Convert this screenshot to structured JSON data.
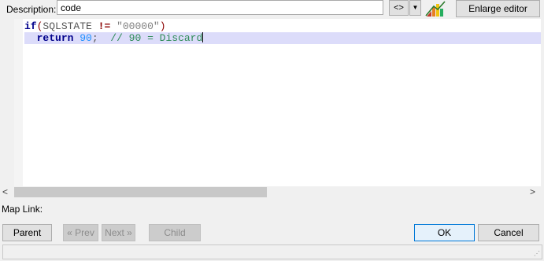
{
  "description": {
    "label": "Description:",
    "value": "code"
  },
  "toolbar": {
    "code_toggle_label": "<>",
    "dropdown_icon": "chevron-down-icon",
    "chart_icon": "chart-icon",
    "enlarge_label": "Enlarge editor"
  },
  "editor": {
    "lines": [
      {
        "tokens": {
          "kw": "if",
          "open": "(",
          "ident": "SQLSTATE",
          "op": "!=",
          "str": "\"00000\"",
          "close": ")"
        }
      },
      {
        "tokens": {
          "kw": "return",
          "num": "90",
          "semi": ";",
          "comment": "// 90 = Discard"
        }
      }
    ],
    "highlight_color": "#dcdcfa"
  },
  "scroll": {
    "left_icon": "scroll-left-icon",
    "right_icon": "scroll-right-icon"
  },
  "map_link": {
    "label": "Map Link:"
  },
  "buttons": {
    "parent": "Parent",
    "prev": "« Prev",
    "next": "Next »",
    "child": "Child",
    "ok": "OK",
    "cancel": "Cancel"
  },
  "colors": {
    "keyword": "#00008b",
    "operator": "#8b0000",
    "number": "#1e90ff",
    "comment": "#2e8b57",
    "string": "#808080"
  }
}
